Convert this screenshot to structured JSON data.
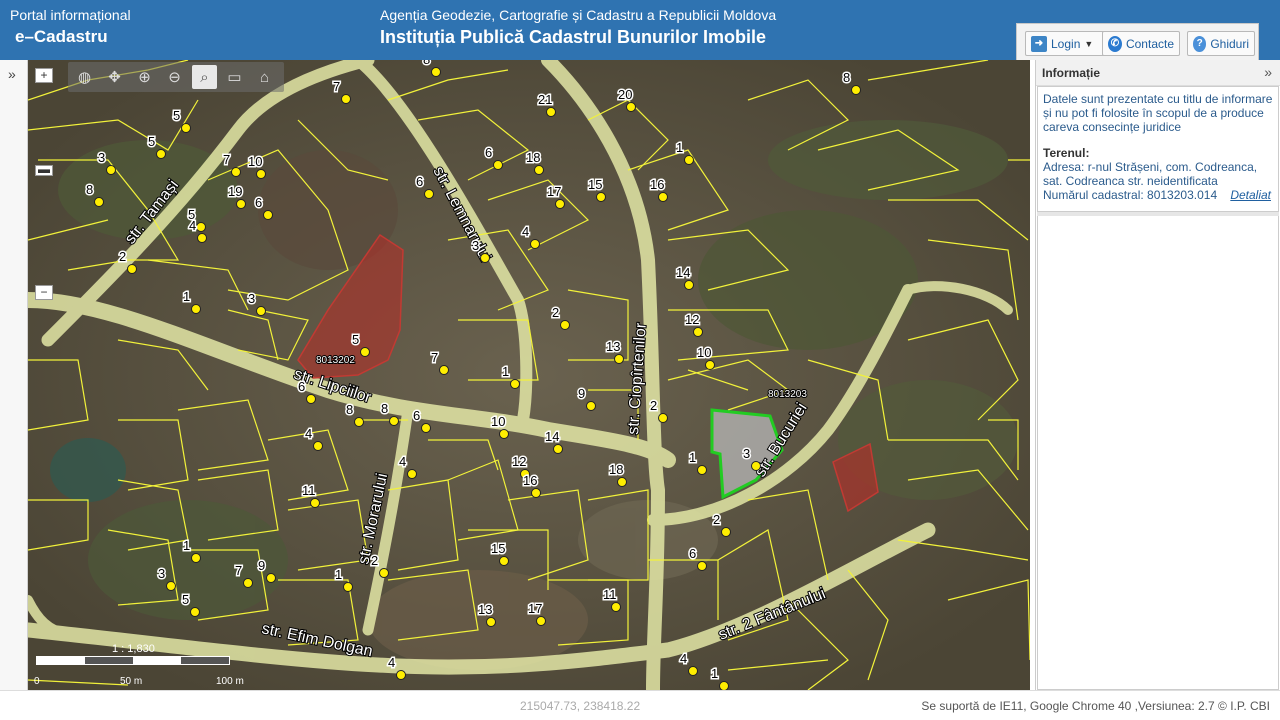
{
  "header": {
    "portal_label": "Portal informațional",
    "app_name": "e–Cadastru",
    "agency": "Agenția Geodezie, Cartografie și Cadastru a Republicii Moldova",
    "institution": "Instituția Publică Cadastrul Bunurilor Imobile",
    "login_label": "Login",
    "contacts_label": "Contacte",
    "guides_label": "Ghiduri"
  },
  "map": {
    "zoom_in": "+",
    "zoom_out": "−",
    "scale_ratio": "1 : 1,830",
    "scale_labels": [
      "0",
      "50 m",
      "100 m"
    ],
    "streets": [
      "str. Tamași",
      "str. Lemnarului",
      "str. Ciopîrtenilor",
      "str. Lipciilor",
      "str. Bucuriei",
      "str. Morarului",
      "str. Efim Dolgan",
      "str. 2 Fântânului"
    ],
    "parcel_labels": [
      "8013202",
      "8013203"
    ],
    "house_numbers": [
      "7",
      "5",
      "8",
      "21",
      "20",
      "8",
      "3",
      "5",
      "7",
      "10",
      "6",
      "6",
      "19",
      "18",
      "1",
      "8",
      "6",
      "5",
      "17",
      "15",
      "16",
      "4",
      "4",
      "3",
      "2",
      "14",
      "1",
      "3",
      "5",
      "2",
      "12",
      "13",
      "10",
      "7",
      "1",
      "9",
      "8",
      "2",
      "6",
      "8",
      "6",
      "10",
      "14",
      "4",
      "1",
      "3",
      "4",
      "12",
      "16",
      "18",
      "11",
      "2",
      "1",
      "15",
      "6",
      "3",
      "7",
      "9",
      "1",
      "2",
      "5",
      "13",
      "17",
      "11",
      "4",
      "4",
      "1"
    ],
    "tools": [
      "globe-icon",
      "pan-icon",
      "zoom-in-icon",
      "zoom-out-icon",
      "identify-icon",
      "print-icon",
      "layers-icon"
    ]
  },
  "panel": {
    "title": "Informație",
    "disclaimer": "Datele sunt prezentate cu titlu de informare și nu pot fi folosite în scopul de a produce careva consecințe juridice",
    "terrain_heading": "Terenul:",
    "address": "Adresa: r-nul Strășeni, com. Codreanca, sat. Codreanca str. neidentificata",
    "cadastral_number": "Numărul cadastral: 8013203.014",
    "detail_link": "Detaliat"
  },
  "footer": {
    "coordinates": "215047.73, 238418.22",
    "support": "Se suportă de IE11, Google Chrome 40 ,Versiunea: 2.7 © I.P. CBI"
  },
  "colors": {
    "header_bg": "#2f73b1",
    "parcel_line": "#f2f23a",
    "highlight": "#22cc22",
    "red_parcel": "#b0302a"
  }
}
